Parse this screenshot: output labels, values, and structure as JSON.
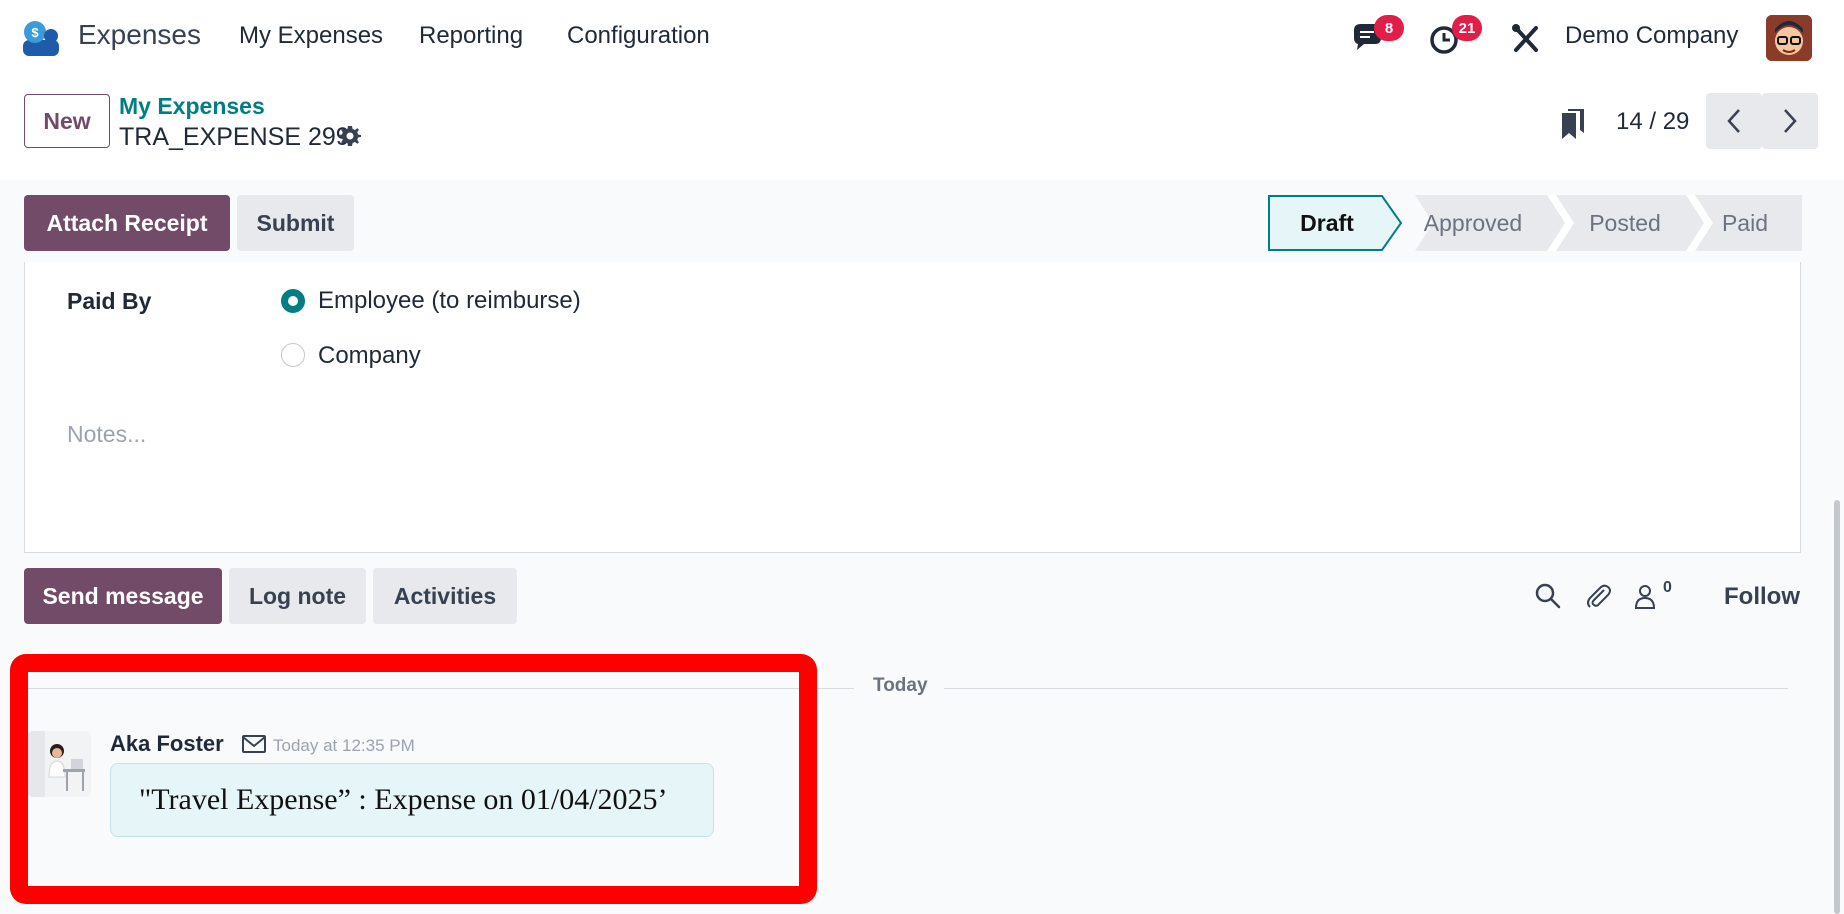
{
  "topnav": {
    "app_name": "Expenses",
    "menu": [
      "My Expenses",
      "Reporting",
      "Configuration"
    ],
    "messages_badge": "8",
    "activities_badge": "21",
    "company": "Demo Company"
  },
  "control": {
    "new_label": "New",
    "breadcrumb": "My Expenses",
    "record_name": "TRA_EXPENSE 299",
    "pager": "14 / 29"
  },
  "statusbar": {
    "attach_receipt": "Attach Receipt",
    "submit": "Submit",
    "stages": [
      "Draft",
      "Approved",
      "Posted",
      "Paid"
    ],
    "active_stage": "Draft"
  },
  "form": {
    "paid_by_label": "Paid By",
    "options": [
      "Employee (to reimburse)",
      "Company"
    ],
    "selected": "Employee (to reimburse)",
    "notes_placeholder": "Notes..."
  },
  "chatter": {
    "send_message": "Send message",
    "log_note": "Log note",
    "activities": "Activities",
    "followers_count": "0",
    "follow": "Follow",
    "date_separator": "Today",
    "message": {
      "author": "Aka Foster",
      "timestamp": "Today at 12:35 PM",
      "body": "\"Travel Expense” : Expense on 01/04/2025’"
    }
  },
  "colors": {
    "primary": "#714b67",
    "teal": "#017e84",
    "badge": "#e11d48",
    "highlight": "#ff0000"
  }
}
